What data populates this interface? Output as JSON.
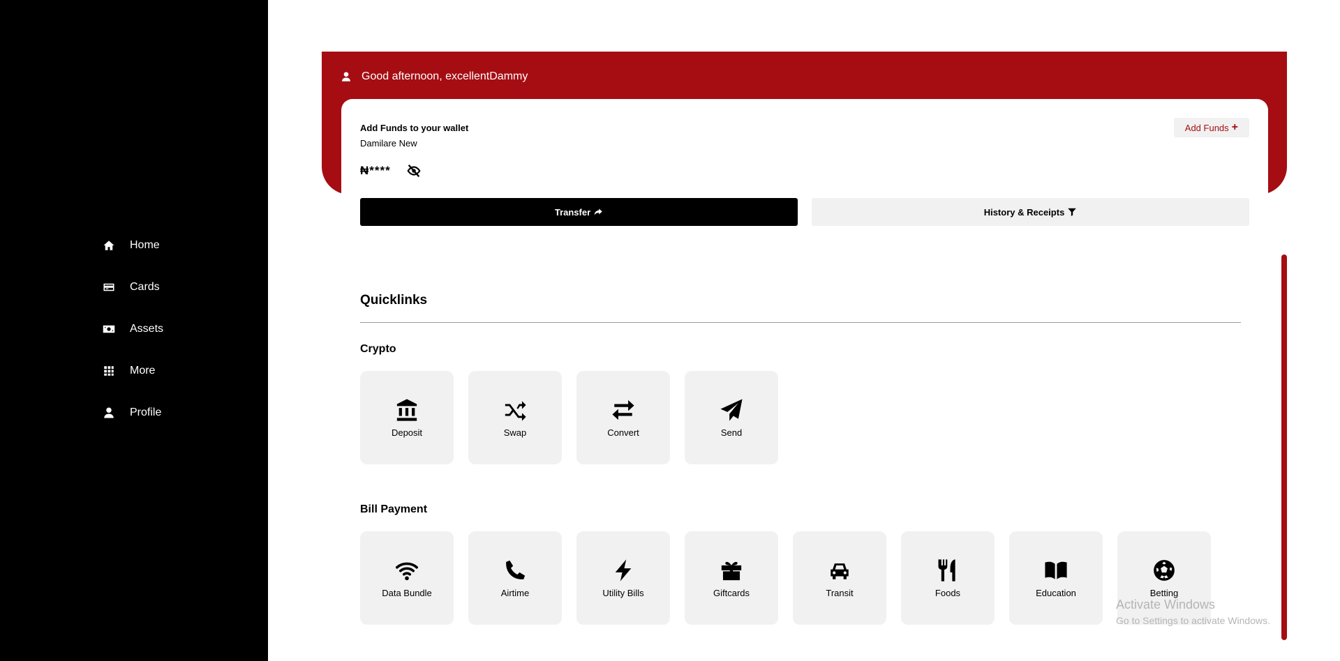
{
  "sidebar": {
    "items": [
      {
        "label": "Home",
        "icon": "home-icon"
      },
      {
        "label": "Cards",
        "icon": "card-icon"
      },
      {
        "label": "Assets",
        "icon": "money-icon"
      },
      {
        "label": "More",
        "icon": "grid-icon"
      },
      {
        "label": "Profile",
        "icon": "user-icon"
      }
    ]
  },
  "header": {
    "greeting": "Good afternoon, excellentDammy"
  },
  "wallet": {
    "title": "Add Funds to your wallet",
    "account_name": "Damilare New",
    "balance": "₦****",
    "add_funds_label": "Add Funds"
  },
  "actions": {
    "transfer_label": "Transfer",
    "history_label": "History & Receipts"
  },
  "quicklinks": {
    "title": "Quicklinks",
    "crypto": {
      "title": "Crypto",
      "items": [
        {
          "label": "Deposit",
          "icon": "bank-icon"
        },
        {
          "label": "Swap",
          "icon": "shuffle-icon"
        },
        {
          "label": "Convert",
          "icon": "exchange-icon"
        },
        {
          "label": "Send",
          "icon": "paper-plane-icon"
        }
      ]
    },
    "bills": {
      "title": "Bill Payment",
      "items": [
        {
          "label": "Data Bundle",
          "icon": "wifi-icon"
        },
        {
          "label": "Airtime",
          "icon": "phone-icon"
        },
        {
          "label": "Utility Bills",
          "icon": "bolt-icon"
        },
        {
          "label": "Giftcards",
          "icon": "gift-icon"
        },
        {
          "label": "Transit",
          "icon": "car-icon"
        },
        {
          "label": "Foods",
          "icon": "utensils-icon"
        },
        {
          "label": "Education",
          "icon": "book-icon"
        },
        {
          "label": "Betting",
          "icon": "soccer-ball-icon"
        }
      ]
    }
  },
  "watermark": {
    "line1": "Activate Windows",
    "line2": "Go to Settings to activate Windows."
  },
  "colors": {
    "brand": "#a50d12",
    "sidebar": "#000000",
    "tile": "#f1f1f1"
  }
}
